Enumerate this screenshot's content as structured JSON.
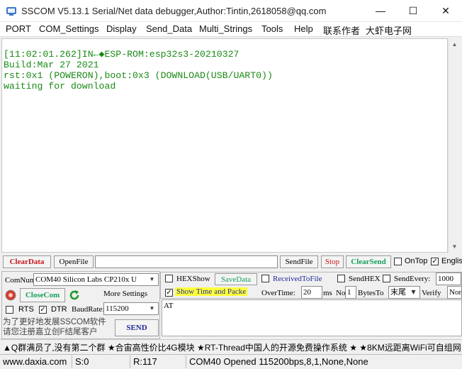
{
  "window": {
    "title": "SSCOM V5.13.1 Serial/Net data debugger,Author:Tintin,2618058@qq.com",
    "minimize_glyph": "—",
    "maximize_glyph": "☐",
    "close_glyph": "✕"
  },
  "menu": [
    "PORT",
    "COM_Settings",
    "Display",
    "Send_Data",
    "Multi_Strings",
    "Tools",
    "Help",
    "联系作者",
    "大虾电子网"
  ],
  "terminal": {
    "lines": [
      "[11:02:01.262]IN←◆ESP-ROM:esp32s3-20210327",
      "Build:Mar 27 2021",
      "rst:0x1 (POWERON),boot:0x3 (DOWNLOAD(USB/UART0))",
      "waiting for download"
    ],
    "text_color": "#1a8a16"
  },
  "filebar": {
    "clear_data": "ClearData",
    "open_file": "OpenFile",
    "file_path": "",
    "send_file": "SendFile",
    "stop": "Stop",
    "clear_send": "ClearSend",
    "ontop_label": "OnTop",
    "ontop_checked": false,
    "english_label": "English",
    "english_checked": true
  },
  "port": {
    "comnum_label": "ComNum",
    "com_value": "COM40 Silicon Labs CP210x U",
    "close_com": "CloseCom",
    "more_settings": "More Settings",
    "rts_label": "RTS",
    "rts_checked": false,
    "dtr_label": "DTR",
    "dtr_checked": true,
    "baud_label": "BaudRate:",
    "baud_value": "115200",
    "promo": "为了更好地发展SSCOM软件\n请您注册嘉立创F结尾客户"
  },
  "options": {
    "hexshow": "HEXShow",
    "hexshow_checked": false,
    "save_data": "SaveData",
    "received_to_file": "ReceivedToFile",
    "received_checked": false,
    "send_hex": "SendHEX",
    "send_hex_checked": false,
    "send_every": "SendEvery:",
    "send_every_checked": false,
    "send_every_value": "1000",
    "show_time": "Show Time and Packe",
    "show_time_checked": true,
    "overtime_label": "OverTime:",
    "overtime_value": "20",
    "ms_label": "ms",
    "no_label": "No",
    "no_value": "1",
    "bytes_to_label": "BytesTo",
    "end_value": "末尾",
    "verify_label": "Verify",
    "verify_value": "None",
    "send_button": "SEND",
    "send_text": "AT"
  },
  "ticker": "▲Q群满员了,没有第二个群 ★合宙高性价比4G模块 ★RT-Thread中国人的开源免费操作系统 ★ ★8KM远距离WiFi可自组网",
  "status": {
    "site": "www.daxia.com",
    "s_count": "S:0",
    "r_count": "R:117",
    "port_state": "COM40 Opened  115200bps,8,1,None,None"
  }
}
